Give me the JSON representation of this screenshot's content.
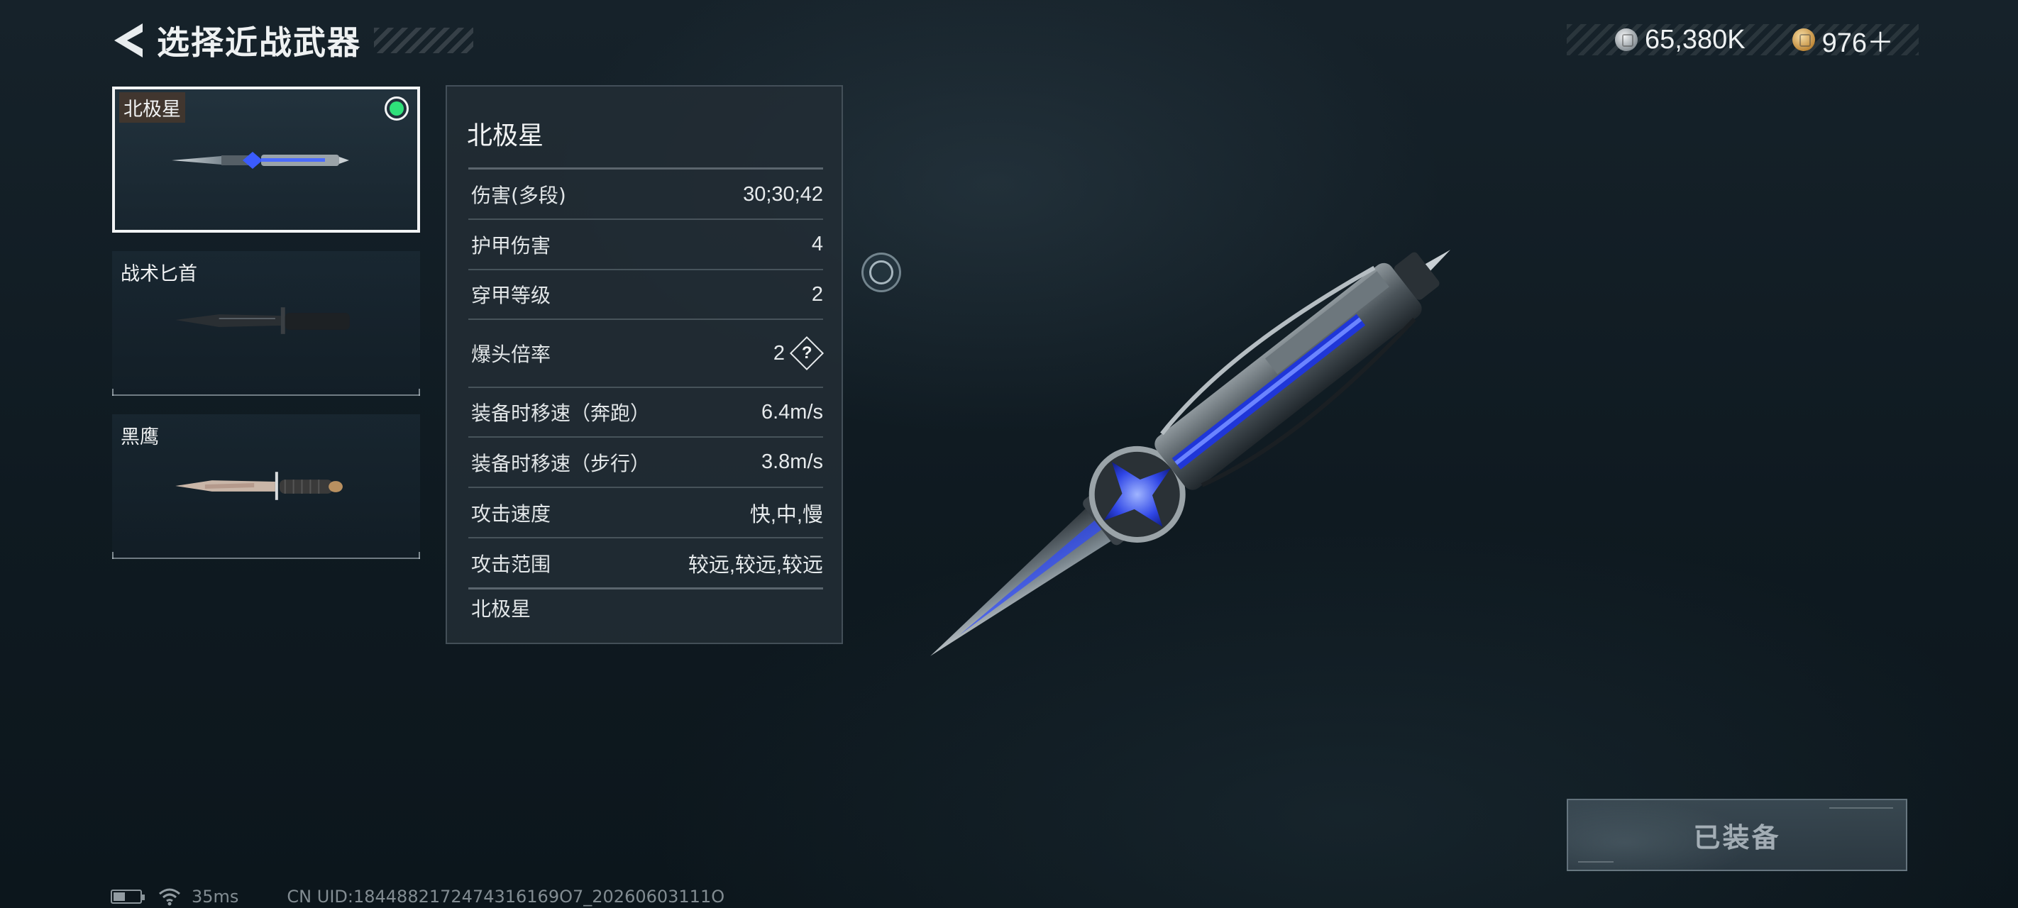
{
  "header": {
    "title": "选择近战武器"
  },
  "currency": {
    "silver_value": "65,380K",
    "gold_value": "976＋"
  },
  "weapons": [
    {
      "name": "北极星",
      "selected": true,
      "equipped": true
    },
    {
      "name": "战术匕首",
      "selected": false,
      "equipped": false
    },
    {
      "name": "黑鹰",
      "selected": false,
      "equipped": false
    }
  ],
  "stats": {
    "title": "北极星",
    "rows": [
      {
        "label": "伤害(多段)",
        "value": "30;30;42"
      },
      {
        "label": "护甲伤害",
        "value": "4"
      },
      {
        "label": "穿甲等级",
        "value": "2"
      },
      {
        "label": "爆头倍率",
        "value": "2",
        "help": "?"
      },
      {
        "label": "装备时移速（奔跑）",
        "value": "6.4m/s"
      },
      {
        "label": "装备时移速（步行）",
        "value": "3.8m/s"
      },
      {
        "label": "攻击速度",
        "value": "快,中,慢"
      },
      {
        "label": "攻击范围",
        "value": "较远,较远,较远"
      }
    ],
    "footer": "北极星"
  },
  "equip_button": {
    "label": "已装备"
  },
  "status_bar": {
    "ping": "35ms",
    "uid": "CN UID:1844882172474316169O7_20260603111O"
  },
  "colors": {
    "equipped_indicator": "#2fe07a",
    "background": "#0f1a21",
    "panel": "#222c34"
  },
  "icons": [
    "back-arrow-icon",
    "silver-coin-icon",
    "gold-coin-icon",
    "equipped-check-icon",
    "help-icon",
    "rotate-view-icon",
    "battery-icon",
    "wifi-icon"
  ]
}
